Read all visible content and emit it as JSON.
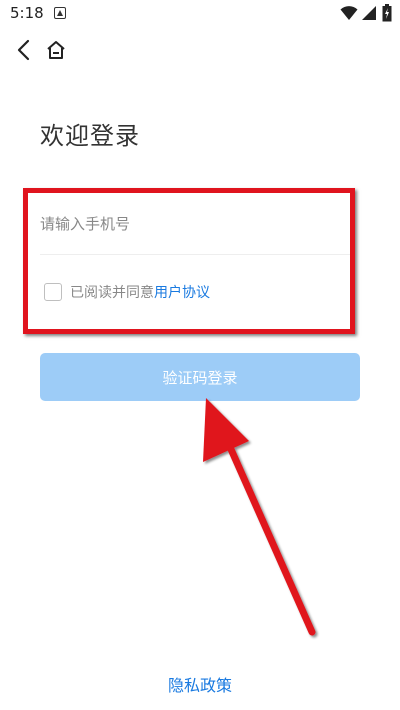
{
  "status_bar": {
    "time": "5:18"
  },
  "nav": {
    "back_icon": "back-arrow-icon",
    "home_icon": "home-icon"
  },
  "title": "欢迎登录",
  "form": {
    "phone_placeholder": "请输入手机号",
    "phone_value": "",
    "agree_text": "已阅读并同意",
    "agree_link": "用户协议",
    "agree_checked": false
  },
  "login_button": {
    "label": "验证码登录",
    "enabled": false
  },
  "footer": {
    "privacy_link": "隐私政策"
  },
  "colors": {
    "accent": "#1a7ae0",
    "button_disabled": "#9dccf7",
    "annotation": "#e0141e"
  }
}
